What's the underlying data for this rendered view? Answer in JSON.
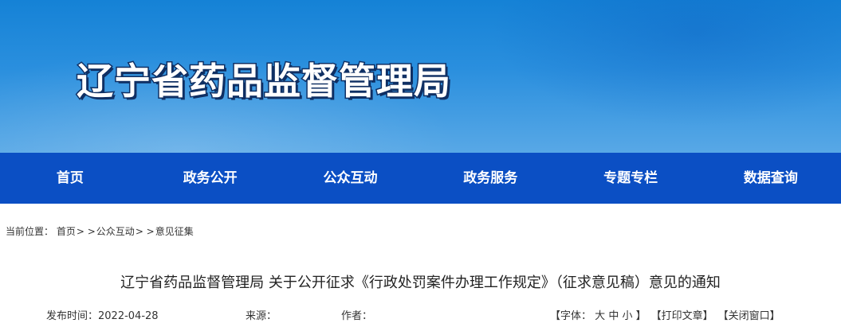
{
  "header": {
    "site_title": "辽宁省药品监督管理局"
  },
  "nav": {
    "items": [
      {
        "label": "首页"
      },
      {
        "label": "政务公开"
      },
      {
        "label": "公众互动"
      },
      {
        "label": "政务服务"
      },
      {
        "label": "专题专栏"
      },
      {
        "label": "数据查询"
      }
    ]
  },
  "breadcrumb": {
    "prefix": "当前位置：",
    "items": [
      "首页",
      "公众互动",
      "意见征集"
    ],
    "separator": "> >"
  },
  "article": {
    "title": "辽宁省药品监督管理局 关于公开征求《行政处罚案件办理工作规定》（征求意见稿）意见的通知",
    "publish_label": "发布时间：",
    "publish_date": "2022-04-28",
    "source_label": "来源：",
    "author_label": "作者："
  },
  "tools": {
    "font_open": "【字体：",
    "font_large": "大",
    "font_medium": "中",
    "font_small": "小",
    "font_close": "】",
    "print": "【打印文章】",
    "close": "【关闭窗口】"
  },
  "colors": {
    "banner": "#1a84d8",
    "nav": "#0b4fc4",
    "title_outline": "#0f2f63"
  }
}
